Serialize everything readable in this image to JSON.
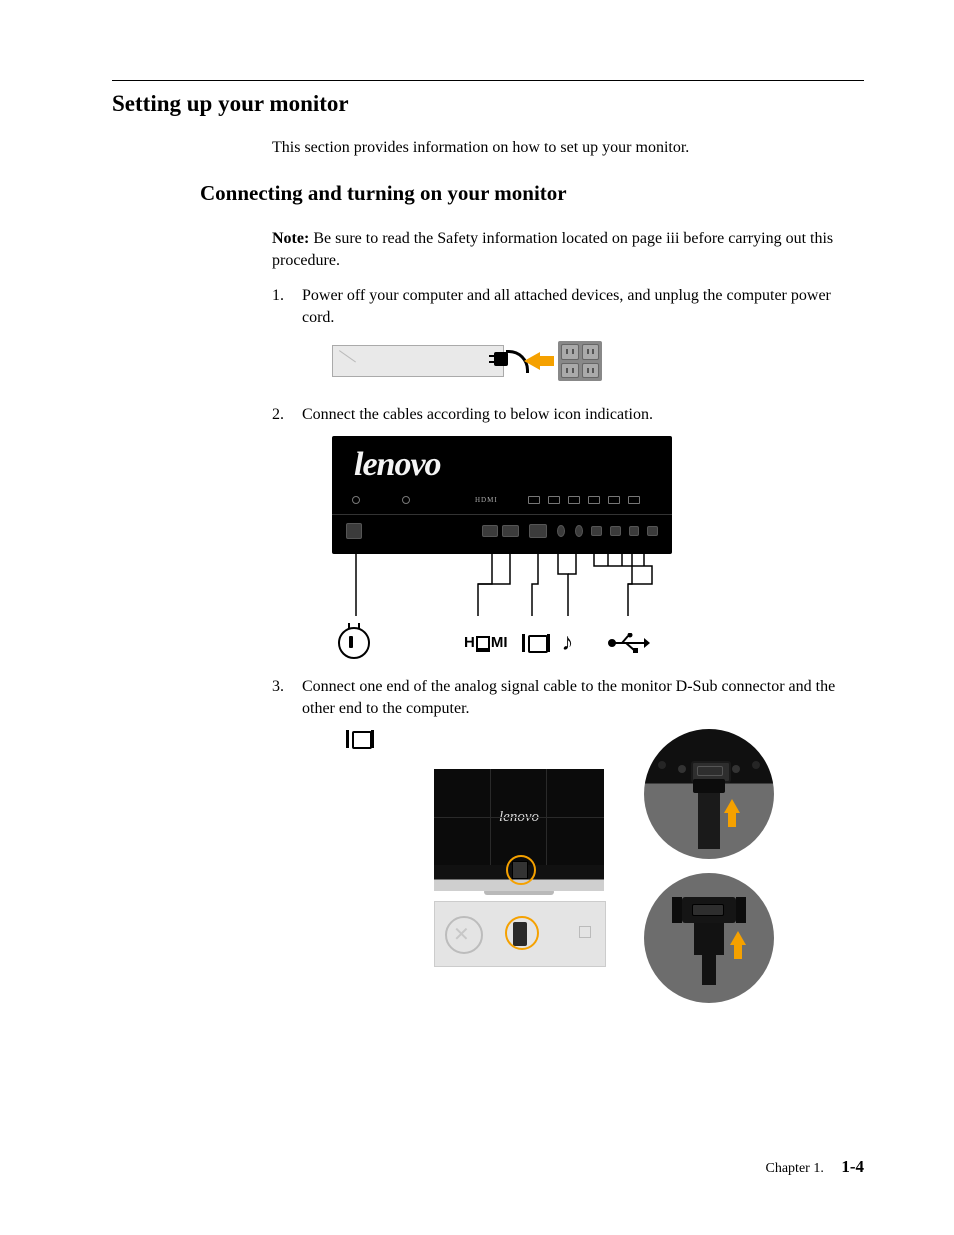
{
  "section_title": "Setting up your monitor",
  "intro_text": "This section provides information on how to set up your monitor.",
  "subsection_title": "Connecting and turning on your monitor",
  "note_label": "Note:",
  "note_text": " Be sure to read the Safety information located on page iii before carrying out this procedure.",
  "steps": {
    "s1": {
      "num": "1.",
      "text": "Power off your computer and all attached devices, and unplug the computer power cord."
    },
    "s2": {
      "num": "2.",
      "text": "Connect the cables according to below icon indication."
    },
    "s3": {
      "num": "3.",
      "text": "Connect one end of the analog signal cable to the monitor D-Sub connector and the other end to the computer."
    }
  },
  "fig2": {
    "brand": "lenovo",
    "hdmi_small": "HDMI",
    "icon_hdmi_text_left": "H",
    "icon_hdmi_text_right": "MI"
  },
  "fig3": {
    "screen_brand": "lenovo"
  },
  "footer": {
    "chapter": "Chapter 1.",
    "page": "1-4"
  }
}
